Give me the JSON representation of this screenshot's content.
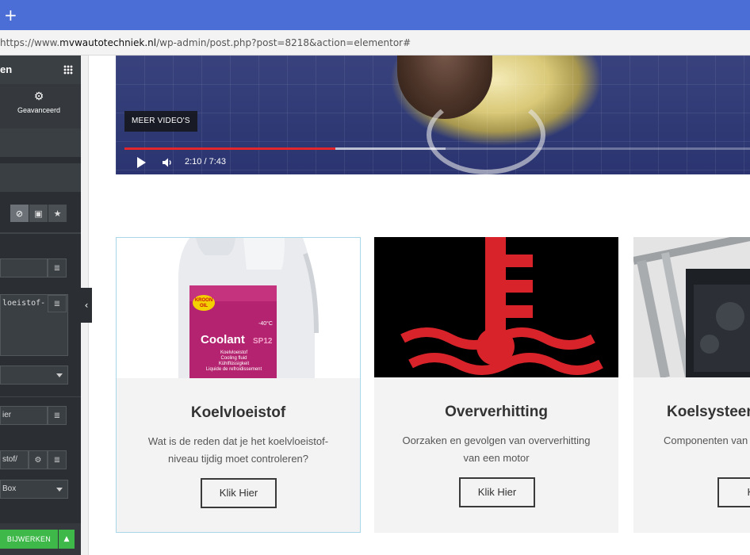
{
  "browser": {
    "new_tab": "+",
    "url_prefix": "https://www.",
    "url_domain": "mvwautotechniek.nl",
    "url_path": "/wp-admin/post.php?post=8218&action=elementor#"
  },
  "panel": {
    "title": "en",
    "advanced_tab": "Geavanceerd",
    "textarea_value": "loeistof-",
    "field_link": "ier",
    "field_slug": "stof/",
    "select_value": "Box",
    "update_button": "BIJWERKEN",
    "update_arrow": "▲",
    "collapse": "‹",
    "icon_names": [
      "no-image-icon",
      "image-icon",
      "star-icon"
    ]
  },
  "video": {
    "more_videos": "MEER VIDEO'S",
    "time": "2:10 / 7:43",
    "progress_played": 0.337,
    "progress_buffered": 0.513
  },
  "cards": [
    {
      "title": "Koelvloeistof",
      "desc": "Wat is de reden dat je het koelvloeistof-niveau tijdig moet controleren?",
      "button": "Klik Hier",
      "image_label_brand": "KROON OIL",
      "image_label_product": "Coolant",
      "image_label_code": "SP12",
      "image_label_temp": "-40°C",
      "image_label_lines": [
        "Koelvloeistof",
        "Cooling fluid",
        "Kühlflüssigkeit",
        "Liquide de refroidissement"
      ]
    },
    {
      "title": "Oververhitting",
      "desc": "Oorzaken en gevolgen van oververhitting van een motor",
      "button": "Klik Hier"
    },
    {
      "title": "Koelsysteem",
      "desc": "Componenten van een ben",
      "button": "Klik"
    }
  ],
  "colors": {
    "browser_bar": "#4a6dd6",
    "panel_bg": "#2b2f33",
    "update_green": "#3fb84a",
    "progress_red": "#e2262b",
    "card_border_active": "#a9d6e8"
  }
}
